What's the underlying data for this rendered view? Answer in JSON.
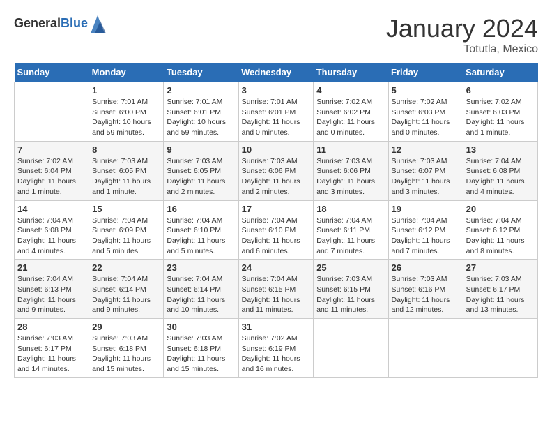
{
  "header": {
    "logo_general": "General",
    "logo_blue": "Blue",
    "month_title": "January 2024",
    "location": "Totutla, Mexico"
  },
  "weekdays": [
    "Sunday",
    "Monday",
    "Tuesday",
    "Wednesday",
    "Thursday",
    "Friday",
    "Saturday"
  ],
  "weeks": [
    [
      {
        "day": "",
        "sunrise": "",
        "sunset": "",
        "daylight": ""
      },
      {
        "day": "1",
        "sunrise": "Sunrise: 7:01 AM",
        "sunset": "Sunset: 6:00 PM",
        "daylight": "Daylight: 10 hours and 59 minutes."
      },
      {
        "day": "2",
        "sunrise": "Sunrise: 7:01 AM",
        "sunset": "Sunset: 6:01 PM",
        "daylight": "Daylight: 10 hours and 59 minutes."
      },
      {
        "day": "3",
        "sunrise": "Sunrise: 7:01 AM",
        "sunset": "Sunset: 6:01 PM",
        "daylight": "Daylight: 11 hours and 0 minutes."
      },
      {
        "day": "4",
        "sunrise": "Sunrise: 7:02 AM",
        "sunset": "Sunset: 6:02 PM",
        "daylight": "Daylight: 11 hours and 0 minutes."
      },
      {
        "day": "5",
        "sunrise": "Sunrise: 7:02 AM",
        "sunset": "Sunset: 6:03 PM",
        "daylight": "Daylight: 11 hours and 0 minutes."
      },
      {
        "day": "6",
        "sunrise": "Sunrise: 7:02 AM",
        "sunset": "Sunset: 6:03 PM",
        "daylight": "Daylight: 11 hours and 1 minute."
      }
    ],
    [
      {
        "day": "7",
        "sunrise": "Sunrise: 7:02 AM",
        "sunset": "Sunset: 6:04 PM",
        "daylight": "Daylight: 11 hours and 1 minute."
      },
      {
        "day": "8",
        "sunrise": "Sunrise: 7:03 AM",
        "sunset": "Sunset: 6:05 PM",
        "daylight": "Daylight: 11 hours and 1 minute."
      },
      {
        "day": "9",
        "sunrise": "Sunrise: 7:03 AM",
        "sunset": "Sunset: 6:05 PM",
        "daylight": "Daylight: 11 hours and 2 minutes."
      },
      {
        "day": "10",
        "sunrise": "Sunrise: 7:03 AM",
        "sunset": "Sunset: 6:06 PM",
        "daylight": "Daylight: 11 hours and 2 minutes."
      },
      {
        "day": "11",
        "sunrise": "Sunrise: 7:03 AM",
        "sunset": "Sunset: 6:06 PM",
        "daylight": "Daylight: 11 hours and 3 minutes."
      },
      {
        "day": "12",
        "sunrise": "Sunrise: 7:03 AM",
        "sunset": "Sunset: 6:07 PM",
        "daylight": "Daylight: 11 hours and 3 minutes."
      },
      {
        "day": "13",
        "sunrise": "Sunrise: 7:04 AM",
        "sunset": "Sunset: 6:08 PM",
        "daylight": "Daylight: 11 hours and 4 minutes."
      }
    ],
    [
      {
        "day": "14",
        "sunrise": "Sunrise: 7:04 AM",
        "sunset": "Sunset: 6:08 PM",
        "daylight": "Daylight: 11 hours and 4 minutes."
      },
      {
        "day": "15",
        "sunrise": "Sunrise: 7:04 AM",
        "sunset": "Sunset: 6:09 PM",
        "daylight": "Daylight: 11 hours and 5 minutes."
      },
      {
        "day": "16",
        "sunrise": "Sunrise: 7:04 AM",
        "sunset": "Sunset: 6:10 PM",
        "daylight": "Daylight: 11 hours and 5 minutes."
      },
      {
        "day": "17",
        "sunrise": "Sunrise: 7:04 AM",
        "sunset": "Sunset: 6:10 PM",
        "daylight": "Daylight: 11 hours and 6 minutes."
      },
      {
        "day": "18",
        "sunrise": "Sunrise: 7:04 AM",
        "sunset": "Sunset: 6:11 PM",
        "daylight": "Daylight: 11 hours and 7 minutes."
      },
      {
        "day": "19",
        "sunrise": "Sunrise: 7:04 AM",
        "sunset": "Sunset: 6:12 PM",
        "daylight": "Daylight: 11 hours and 7 minutes."
      },
      {
        "day": "20",
        "sunrise": "Sunrise: 7:04 AM",
        "sunset": "Sunset: 6:12 PM",
        "daylight": "Daylight: 11 hours and 8 minutes."
      }
    ],
    [
      {
        "day": "21",
        "sunrise": "Sunrise: 7:04 AM",
        "sunset": "Sunset: 6:13 PM",
        "daylight": "Daylight: 11 hours and 9 minutes."
      },
      {
        "day": "22",
        "sunrise": "Sunrise: 7:04 AM",
        "sunset": "Sunset: 6:14 PM",
        "daylight": "Daylight: 11 hours and 9 minutes."
      },
      {
        "day": "23",
        "sunrise": "Sunrise: 7:04 AM",
        "sunset": "Sunset: 6:14 PM",
        "daylight": "Daylight: 11 hours and 10 minutes."
      },
      {
        "day": "24",
        "sunrise": "Sunrise: 7:04 AM",
        "sunset": "Sunset: 6:15 PM",
        "daylight": "Daylight: 11 hours and 11 minutes."
      },
      {
        "day": "25",
        "sunrise": "Sunrise: 7:03 AM",
        "sunset": "Sunset: 6:15 PM",
        "daylight": "Daylight: 11 hours and 11 minutes."
      },
      {
        "day": "26",
        "sunrise": "Sunrise: 7:03 AM",
        "sunset": "Sunset: 6:16 PM",
        "daylight": "Daylight: 11 hours and 12 minutes."
      },
      {
        "day": "27",
        "sunrise": "Sunrise: 7:03 AM",
        "sunset": "Sunset: 6:17 PM",
        "daylight": "Daylight: 11 hours and 13 minutes."
      }
    ],
    [
      {
        "day": "28",
        "sunrise": "Sunrise: 7:03 AM",
        "sunset": "Sunset: 6:17 PM",
        "daylight": "Daylight: 11 hours and 14 minutes."
      },
      {
        "day": "29",
        "sunrise": "Sunrise: 7:03 AM",
        "sunset": "Sunset: 6:18 PM",
        "daylight": "Daylight: 11 hours and 15 minutes."
      },
      {
        "day": "30",
        "sunrise": "Sunrise: 7:03 AM",
        "sunset": "Sunset: 6:18 PM",
        "daylight": "Daylight: 11 hours and 15 minutes."
      },
      {
        "day": "31",
        "sunrise": "Sunrise: 7:02 AM",
        "sunset": "Sunset: 6:19 PM",
        "daylight": "Daylight: 11 hours and 16 minutes."
      },
      {
        "day": "",
        "sunrise": "",
        "sunset": "",
        "daylight": ""
      },
      {
        "day": "",
        "sunrise": "",
        "sunset": "",
        "daylight": ""
      },
      {
        "day": "",
        "sunrise": "",
        "sunset": "",
        "daylight": ""
      }
    ]
  ]
}
